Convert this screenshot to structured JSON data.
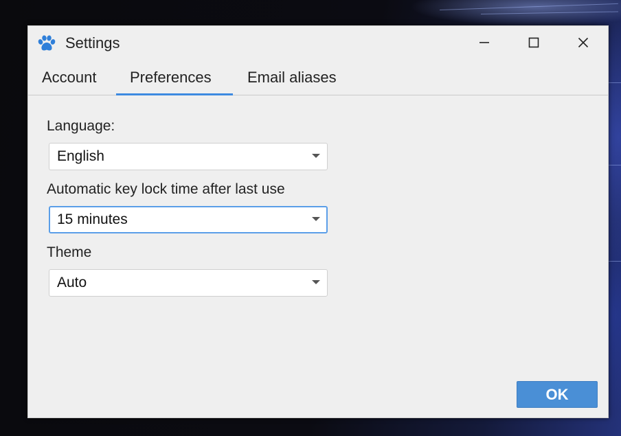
{
  "window": {
    "title": "Settings",
    "app_icon": "paw-icon",
    "controls": [
      "minimize-icon",
      "maximize-icon",
      "close-icon"
    ]
  },
  "tabs": [
    {
      "label": "Account",
      "active": false
    },
    {
      "label": "Preferences",
      "active": true
    },
    {
      "label": "Email aliases",
      "active": false
    }
  ],
  "preferences": {
    "language": {
      "label": "Language:",
      "value": "English"
    },
    "key_lock": {
      "label": "Automatic key lock time after last use",
      "value": "15 minutes"
    },
    "theme": {
      "label": "Theme",
      "value": "Auto"
    }
  },
  "footer": {
    "ok_label": "OK"
  },
  "colors": {
    "accent": "#3d8ae0",
    "button": "#4a8fd6",
    "window_bg": "#efefef"
  }
}
